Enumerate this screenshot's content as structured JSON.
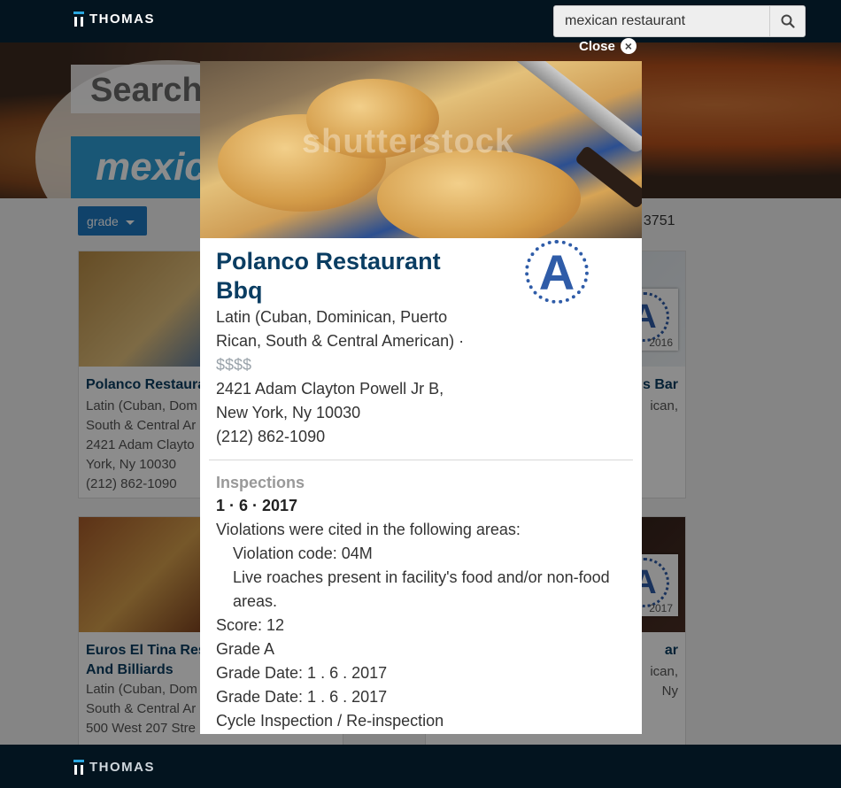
{
  "header": {
    "logo_text": "THOMAS",
    "search_value": "mexican restaurant",
    "search_icon": "magnifier"
  },
  "hero": {
    "search_label": "Search",
    "query_tag": "mexic"
  },
  "filters": {
    "grade_label": "grade",
    "count_text": "f 3751"
  },
  "cards": [
    {
      "title": "Polanco Restaura",
      "lines": [
        "Latin (Cuban, Dom",
        "South & Central Ar",
        "2421 Adam Clayto",
        "York, Ny 10030",
        "(212) 862-1090"
      ]
    },
    {
      "title": "s Bar",
      "lines": [
        "ican,"
      ],
      "stamp_year": "2016"
    },
    {
      "title": "Euros El Tina Res",
      "title2": "And Billiards",
      "lines": [
        "Latin (Cuban, Dom",
        "South & Central Ar",
        "500 West 207 Stre"
      ]
    },
    {
      "title": "ar",
      "lines": [
        "ican,",
        "Ny"
      ],
      "stamp_year": "2017"
    }
  ],
  "modal": {
    "close_label": "Close",
    "photo_watermark": "shutterstock",
    "name": "Polanco Restaurant Bbq",
    "grade_letter": "A",
    "cuisine": "Latin (Cuban, Dominican, Puerto Rican, South & Central American) ·",
    "price": "$$$$",
    "address": "2421 Adam Clayton Powell Jr B, New York, Ny 10030",
    "phone": "(212) 862-1090",
    "inspections_heading": "Inspections",
    "inspection_date": "1 · 6 · 2017",
    "violations_intro": "Violations were cited in the following areas:",
    "violation_code": "Violation code: 04M",
    "violation_desc": "Live roaches present in facility's food and/or non-food areas.",
    "score": "Score: 12",
    "grade": "Grade A",
    "grade_date_1": "Grade Date: 1 . 6 . 2017",
    "grade_date_2": "Grade Date: 1 . 6 . 2017",
    "inspection_type": "Cycle Inspection / Re-inspection"
  },
  "footer": {
    "logo_text": "THOMAS"
  },
  "colors": {
    "navy_bar": "#03141f",
    "accent_blue": "#1e78c2",
    "title_blue": "#0a3d62",
    "stamp_blue": "#2f5ca8"
  }
}
